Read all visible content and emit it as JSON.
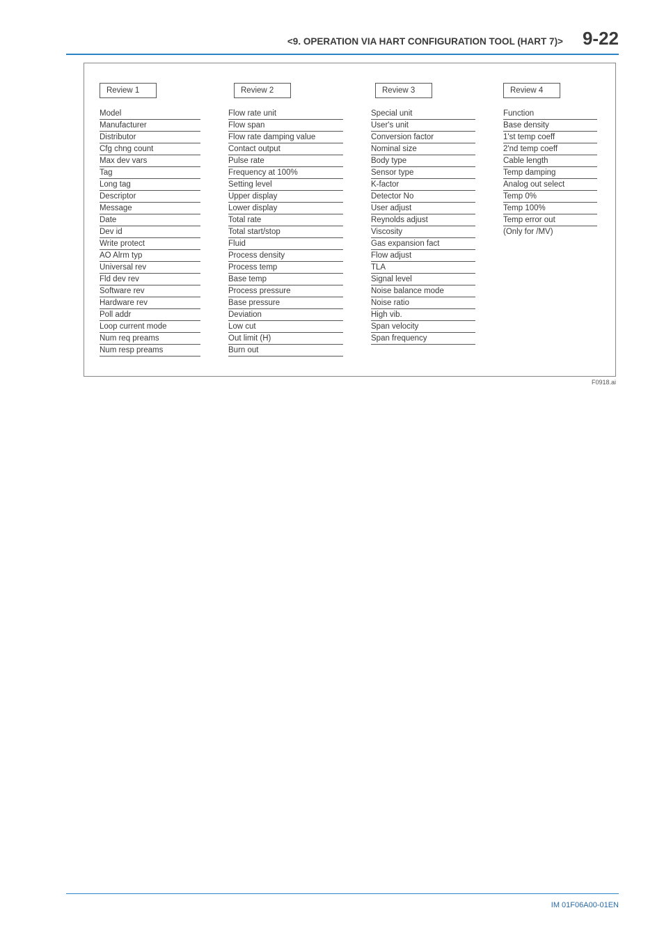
{
  "header": {
    "chapter_title": "<9.  OPERATION VIA HART CONFIGURATION TOOL (HART 7)>",
    "page_number": "9-22"
  },
  "columns": [
    {
      "title": "Review 1",
      "items": [
        "Model",
        "Manufacturer",
        "Distributor",
        "Cfg chng count",
        "Max dev vars",
        "Tag",
        "Long tag",
        "Descriptor",
        "Message",
        "Date",
        "Dev id",
        "Write protect",
        "AO Alrm typ",
        "Universal rev",
        "Fld dev rev",
        "Software rev",
        "Hardware rev",
        "Poll addr",
        "Loop current mode",
        "Num req preams",
        "Num resp preams"
      ]
    },
    {
      "title": "Review 2",
      "items": [
        "Flow rate unit",
        "Flow span",
        "Flow rate damping value",
        "Contact output",
        "Pulse rate",
        "Frequency at 100%",
        "Setting level",
        "Upper display",
        "Lower display",
        "Total rate",
        "Total start/stop",
        "Fluid",
        "Process density",
        "Process temp",
        "Base temp",
        "Process pressure",
        "Base pressure",
        "Deviation",
        "Low cut",
        "Out limit (H)",
        "Burn out"
      ]
    },
    {
      "title": "Review 3",
      "items": [
        "Special unit",
        "User's unit",
        "Conversion factor",
        "Nominal size",
        "Body type",
        "Sensor type",
        "K-factor",
        "Detector No",
        "User adjust",
        "Reynolds adjust",
        "Viscosity",
        "Gas expansion fact",
        "Flow adjust",
        "TLA",
        "Signal level",
        "Noise balance mode",
        "Noise ratio",
        "High vib.",
        "Span velocity",
        "Span frequency"
      ]
    },
    {
      "title": "Review 4",
      "items": [
        "Function",
        "Base density",
        "1'st temp coeff",
        "2'nd temp coeff",
        "Cable length",
        "Temp damping",
        "Analog out select",
        "Temp 0%",
        "Temp 100%",
        "Temp error out"
      ],
      "note": "(Only for /MV)"
    }
  ],
  "figure_ref": "F0918.ai",
  "footer": {
    "doc_number": "IM 01F06A00-01EN"
  }
}
